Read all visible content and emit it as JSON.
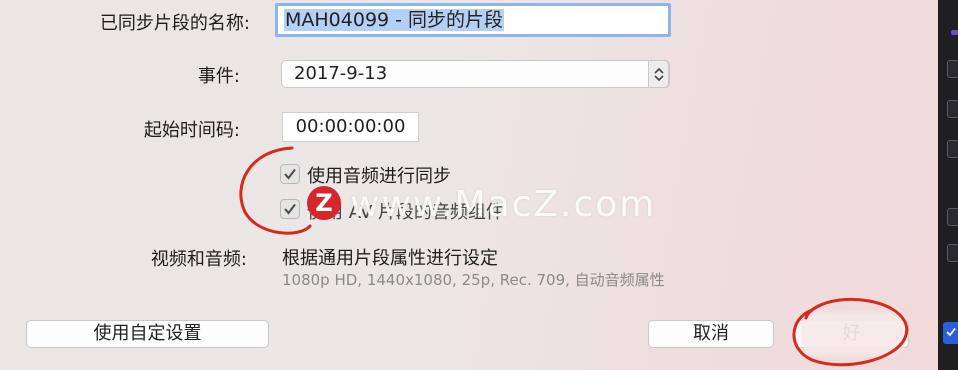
{
  "form": {
    "clip_name_label": "已同步片段的名称:",
    "clip_name_value": "MAH04099 - 同步的片段",
    "event_label": "事件:",
    "event_value": "2017-9-13",
    "start_timecode_label": "起始时间码:",
    "start_timecode_value": "00:00:00:00",
    "use_audio_sync_label": "使用音频进行同步",
    "use_audio_sync_checked": true,
    "second_option_label": "使用 AV 片段的音频组件",
    "second_option_checked": true,
    "video_audio_label": "视频和音频:",
    "video_audio_value": "根据通用片段属性进行设定",
    "video_audio_detail": "1080p HD, 1440x1080, 25p, Rec. 709, 自动音频属性"
  },
  "buttons": {
    "custom_settings": "使用自定设置",
    "cancel": "取消",
    "ok": "好"
  },
  "watermark": {
    "logo_letter": "Z",
    "text": "www.MacZ.com"
  },
  "colors": {
    "annotation_red": "#d62a1e",
    "selection_blue": "#b5d0f5",
    "focus_ring": "#8fb4ea",
    "checkbox_blue": "#2b5fd9"
  }
}
